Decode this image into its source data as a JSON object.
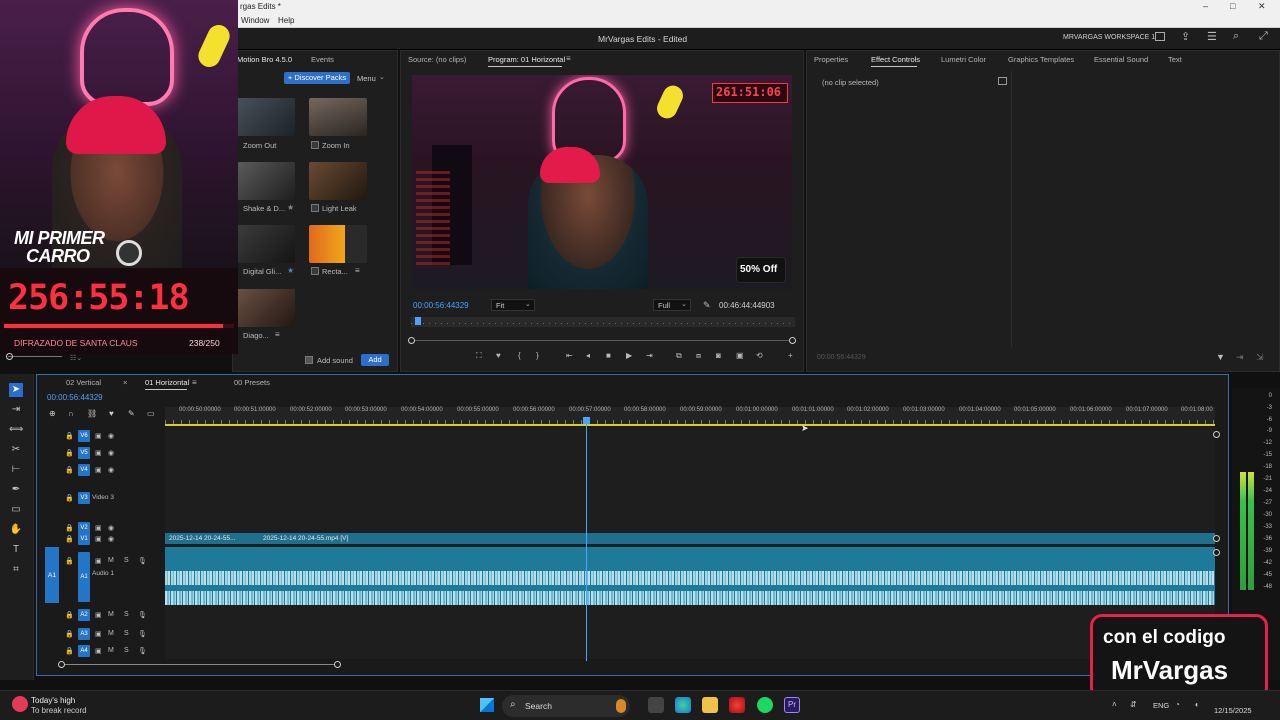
{
  "window": {
    "title_fragment": "rgas Edits *",
    "menus": [
      "Window",
      "Help"
    ],
    "controls": [
      "–",
      "□",
      "✕"
    ]
  },
  "app": {
    "title": "MrVargas Edits - Edited",
    "workspace": "MRVARGAS WORKSPACE 1"
  },
  "left_panel": {
    "tabs": [
      "Motion Bro 4.5.0",
      "Events"
    ],
    "discover_button": "+ Discover Packs",
    "menu_label": "Menu",
    "presets": [
      {
        "label": "Zoom Out"
      },
      {
        "label": "Zoom In"
      },
      {
        "label": "Shake & D..."
      },
      {
        "label": "Light Leak"
      },
      {
        "label": "Digital Gli..."
      },
      {
        "label": "Recta..."
      },
      {
        "label": "Diago..."
      }
    ],
    "add_sound_label": "Add sound",
    "add_button": "Add"
  },
  "source_panel": {
    "tabs": [
      "Source: (no clips)",
      "Program: 01 Horizontal"
    ],
    "timecode": "00:00:56:44329",
    "fit": "Fit",
    "quality": "Full",
    "duration": "00:46:44:44903",
    "overlay_clock": "261:51:06",
    "overlay_badge": "50% Off"
  },
  "effect_panel": {
    "tabs": [
      "Properties",
      "Effect Controls",
      "Lumetri Color",
      "Graphics Templates",
      "Essential Sound",
      "Text"
    ],
    "empty_text": "(no clip selected)",
    "footer_timecode": "00:00:56:44329"
  },
  "timeline": {
    "tabs": [
      "02 Vertical",
      "01 Horizontal",
      "00 Presets"
    ],
    "timecode": "00:00:56:44329",
    "ruler": [
      "00:00:50:00000",
      "00:00:51:00000",
      "00:00:52:00000",
      "00:00:53:00000",
      "00:00:54:00000",
      "00:00:55:00000",
      "00:00:56:00000",
      "00:00:57:00000",
      "00:00:58:00000",
      "00:00:59:00000",
      "00:01:00:00000",
      "00:01:01:00000",
      "00:01:02:00000",
      "00:01:03:00000",
      "00:01:04:00000",
      "00:01:05:00000",
      "00:01:06:00000",
      "00:01:07:00000",
      "00:01:08:00"
    ],
    "video_tracks": [
      "V6",
      "V5",
      "V4",
      "V3",
      "V2",
      "V1"
    ],
    "video3_name": "Video 3",
    "audio_tracks": [
      "A1",
      "A2",
      "A3",
      "A4"
    ],
    "audio1_name": "Audio 1",
    "clip_a": "2025-12-14 20-24-55...",
    "clip_b": "2025-12-14 20-24-55.mp4 [V]",
    "meter_scale": [
      "0",
      "-3",
      "-6",
      "-9",
      "-12",
      "-15",
      "-18",
      "-21",
      "-24",
      "-27",
      "-30",
      "-33",
      "-36",
      "-39",
      "-42",
      "-45",
      "-48"
    ]
  },
  "webcam_overlay": {
    "line1": "MI PRIMER",
    "line2": "CARRO",
    "counter": "256:55:18",
    "goal_label": "DIFRAZADO DE SANTA CLAUS",
    "goal_progress": "238/250",
    "goal_fraction": 0.952
  },
  "promo": {
    "line1": "con el codigo",
    "line2": "MrVargas"
  },
  "taskbar": {
    "weather_title": "Today's high",
    "weather_sub": "To break record",
    "search": "Search",
    "lang": "ENG",
    "date": "12/15/2025"
  },
  "colors": {
    "accent": "#2474c8",
    "clip": "#1f7a9a",
    "counter_red": "#ff3040",
    "promo_border": "#e8204a"
  }
}
